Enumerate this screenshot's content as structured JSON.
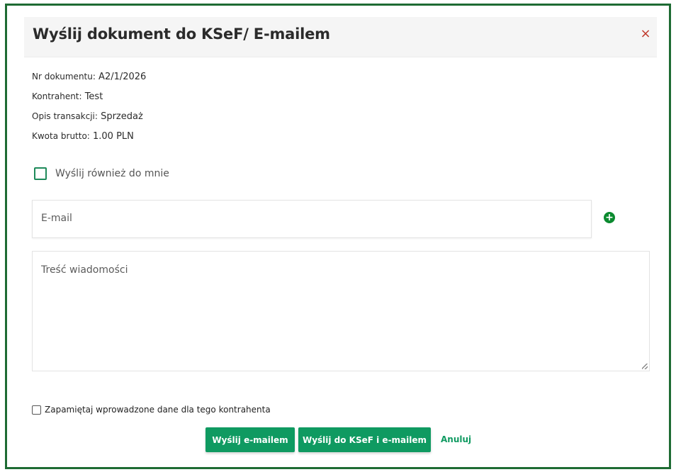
{
  "dialog": {
    "title": "Wyślij dokument do KSeF/ E-mailem",
    "close_symbol": "×"
  },
  "info": {
    "doc_label": "Nr dokumentu:",
    "doc_value": "A2/1/2026",
    "contractor_label": "Kontrahent:",
    "contractor_value": "Test",
    "desc_label": "Opis transakcji:",
    "desc_value": "Sprzedaż",
    "amount_label": "Kwota brutto:",
    "amount_value": "1.00 PLN"
  },
  "send_to_me": {
    "label": "Wyślij również do mnie",
    "checked": false
  },
  "email": {
    "placeholder": "E-mail",
    "value": ""
  },
  "add_icon": {
    "symbol": "+",
    "color": "#0b8a2f"
  },
  "message": {
    "placeholder": "Treść wiadomości",
    "value": ""
  },
  "remember": {
    "label": "Zapamiętaj wprowadzone dane dla tego kontrahenta",
    "checked": false
  },
  "buttons": {
    "send_email": "Wyślij e-mailem",
    "send_ksef_email": "Wyślij do KSeF i e-mailem",
    "cancel": "Anuluj"
  },
  "colors": {
    "primary": "#0f9a61",
    "border": "#1e6b33",
    "close": "#c0392b"
  }
}
